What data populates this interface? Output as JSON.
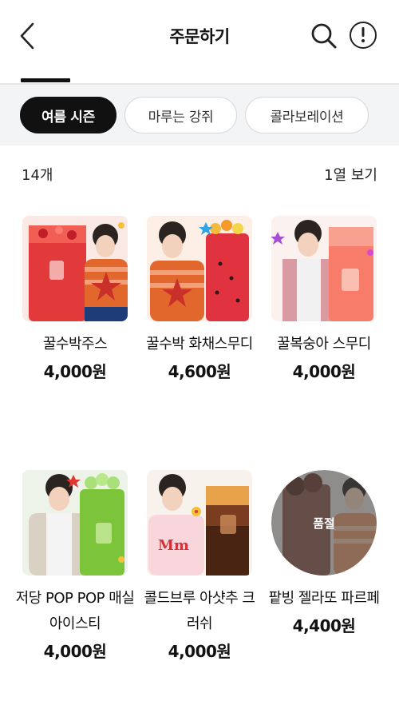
{
  "header": {
    "title": "주문하기",
    "back_icon": "chevron-left-icon",
    "search_icon": "search-icon",
    "info_icon": "info-icon"
  },
  "filters": {
    "chips": [
      {
        "label": "여름 시즌",
        "active": true
      },
      {
        "label": "마루는 강쥐",
        "active": false
      },
      {
        "label": "콜라보레이션",
        "active": false
      }
    ]
  },
  "list": {
    "count_label": "14개",
    "view_label": "1열 보기",
    "items": [
      {
        "name": "꿀수박주스",
        "price": "4,000원",
        "sold_out": false
      },
      {
        "name": "꿀수박 화채스무디",
        "price": "4,600원",
        "sold_out": false
      },
      {
        "name": "꿀복숭아 스무디",
        "price": "4,000원",
        "sold_out": false
      },
      {
        "name": "저당 POP POP 매실 아이스티",
        "price": "4,000원",
        "sold_out": false
      },
      {
        "name": "콜드브루 아샷추 크러쉬",
        "price": "4,000원",
        "sold_out": false
      },
      {
        "name": "팥빙 젤라또 파르페",
        "price": "4,400원",
        "sold_out": true,
        "badge": "품절"
      }
    ]
  },
  "colors": {
    "accent": "#111111",
    "chip_bar_bg": "#f3f4f5"
  }
}
